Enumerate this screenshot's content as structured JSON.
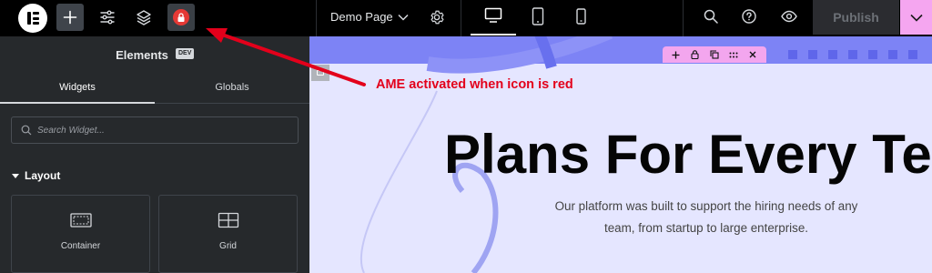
{
  "topbar": {
    "page_name": "Demo Page",
    "publish_label": "Publish"
  },
  "panel": {
    "title": "Elements",
    "badge": "DEV",
    "tabs": [
      {
        "label": "Widgets",
        "active": true
      },
      {
        "label": "Globals",
        "active": false
      }
    ],
    "search_placeholder": "Search Widget...",
    "section_label": "Layout",
    "widgets": [
      {
        "label": "Container",
        "icon": "container-icon"
      },
      {
        "label": "Grid",
        "icon": "grid-icon"
      }
    ]
  },
  "canvas": {
    "headline": "Plans For Every Tea",
    "subtext_line1": "Our platform was built to support the hiring needs of any",
    "subtext_line2": "team, from startup to large enterprise.",
    "element_toolbar_icons": [
      "plus-icon",
      "lock-icon",
      "copy-icon",
      "drag-icon",
      "close-icon"
    ]
  },
  "annotation": {
    "text": "AME activated when icon is red"
  },
  "colors": {
    "ame_red": "#e53935",
    "canvas_bg": "#e5e6ff",
    "accent_purple": "#7d83f5",
    "toolbar_pink": "#f3a6ee",
    "annotation_red": "#e3001b"
  }
}
